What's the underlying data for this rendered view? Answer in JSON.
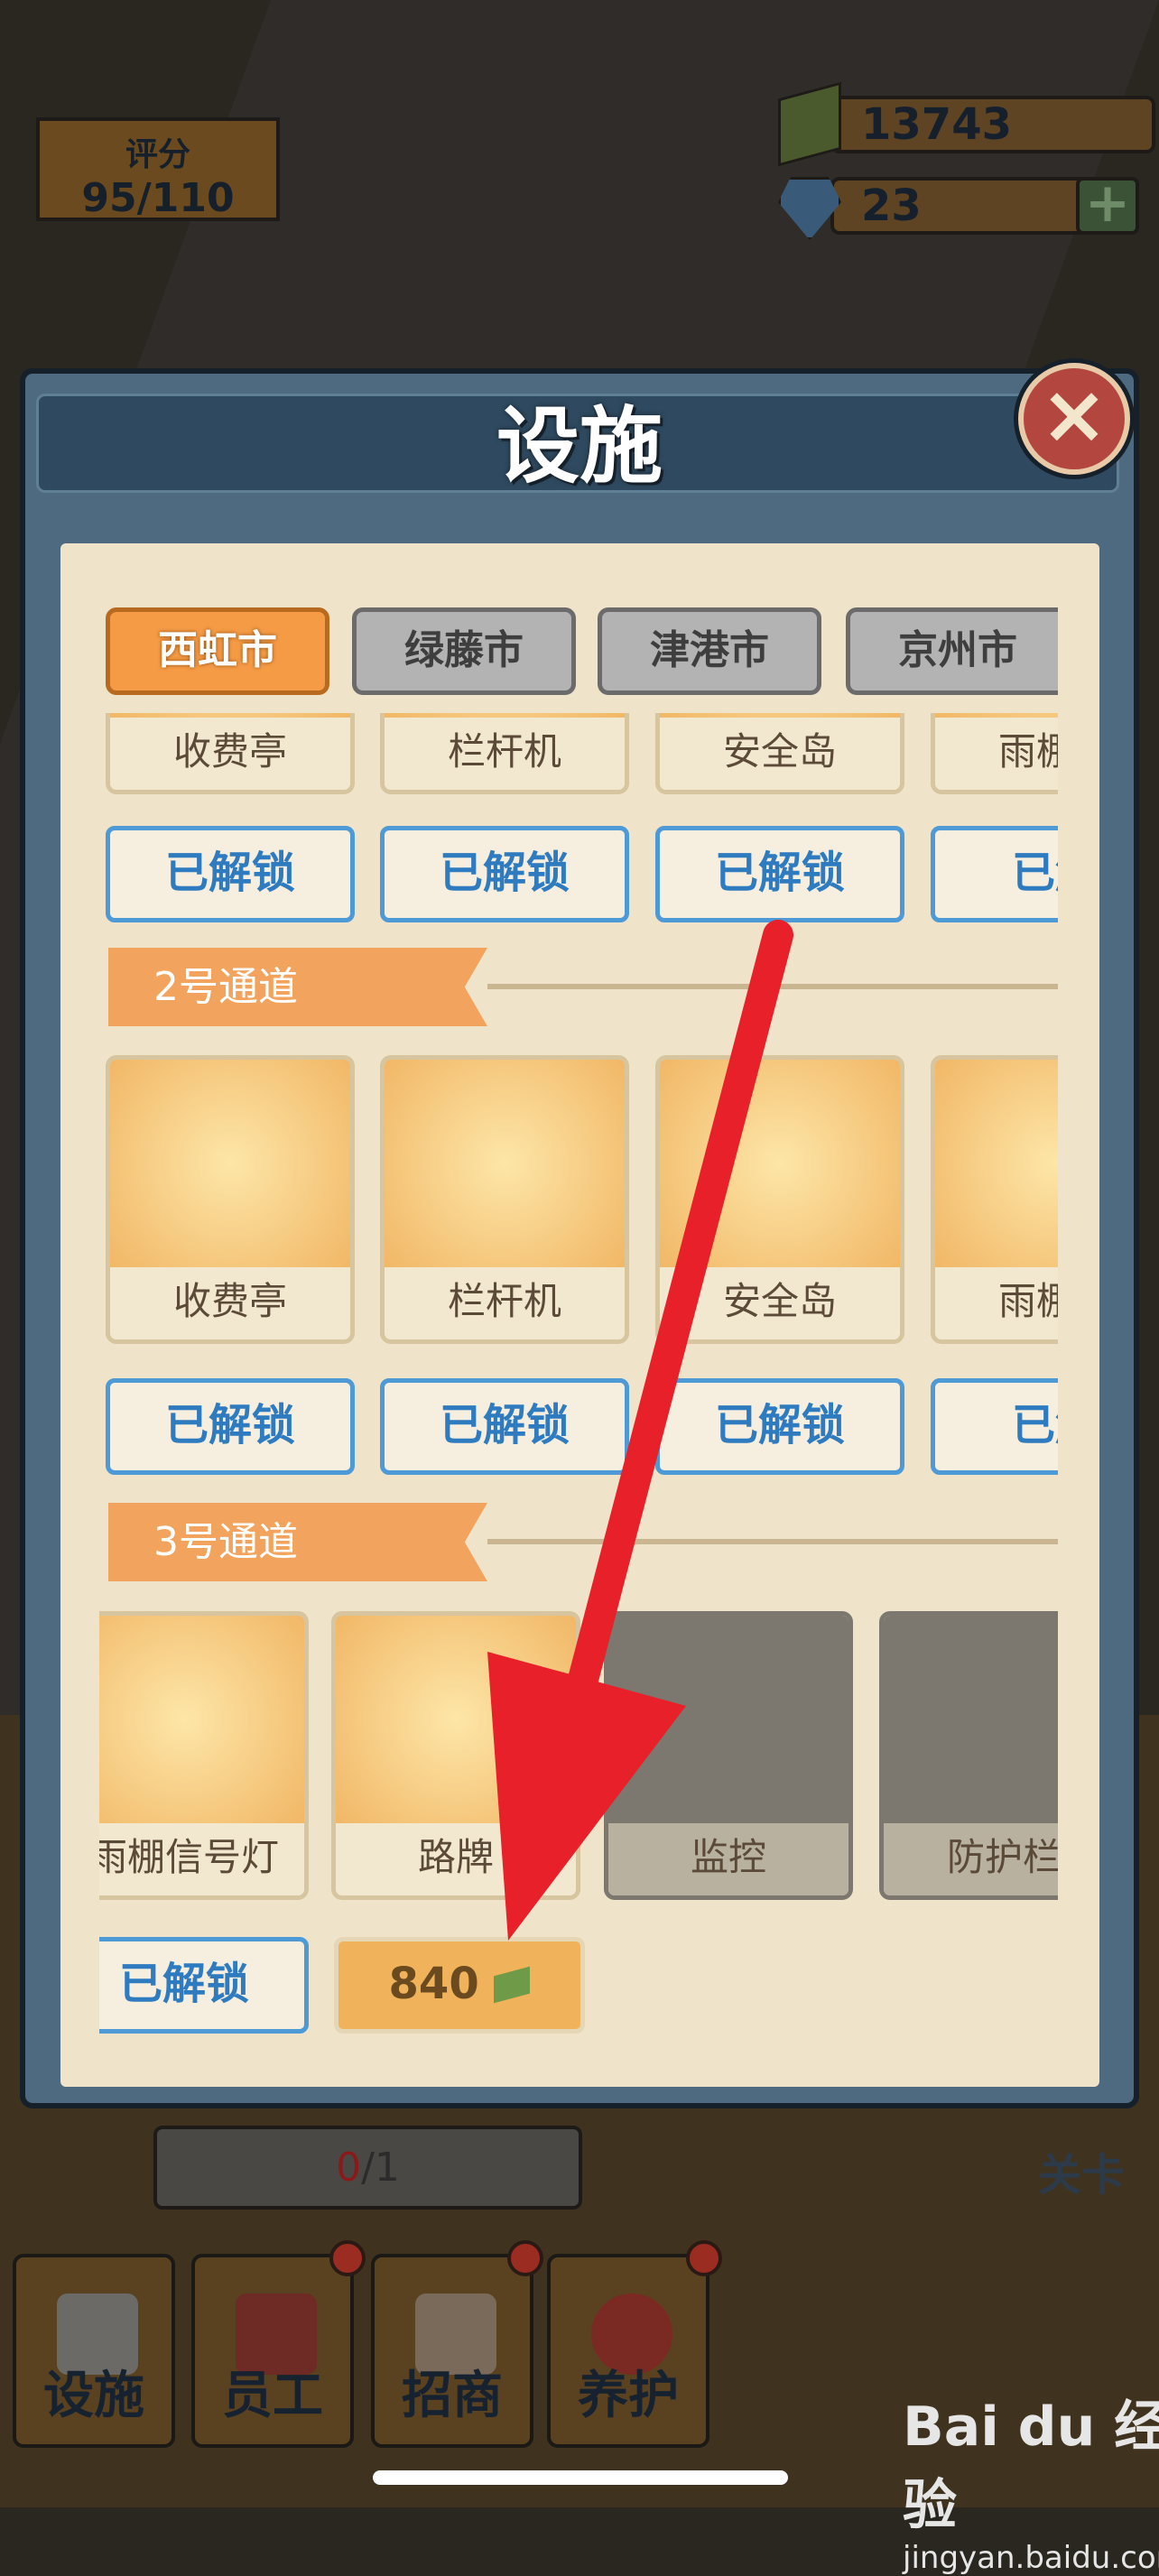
{
  "hud": {
    "rating_label": "评分",
    "rating_value": "95/110",
    "cash": "13743",
    "gems": "23",
    "plus": "+"
  },
  "dialog": {
    "title": "设施",
    "close": "×",
    "tabs": [
      {
        "label": "西虹市",
        "active": true
      },
      {
        "label": "绿藤市",
        "active": false
      },
      {
        "label": "津港市",
        "active": false
      },
      {
        "label": "京州市",
        "active": false
      }
    ],
    "lane1": {
      "items": [
        "收费亭",
        "栏杆机",
        "安全岛",
        "雨棚信"
      ],
      "status": [
        "已解锁",
        "已解锁",
        "已解锁",
        "已解"
      ]
    },
    "lane2": {
      "title": "2号通道",
      "items": [
        "收费亭",
        "栏杆机",
        "安全岛",
        "雨棚信"
      ],
      "status": [
        "已解锁",
        "已解锁",
        "已解锁",
        "已解"
      ]
    },
    "lane3": {
      "title": "3号通道",
      "items": [
        {
          "label": "雨棚信号灯",
          "locked": false
        },
        {
          "label": "路牌",
          "locked": false
        },
        {
          "label": "监控",
          "locked": true
        },
        {
          "label": "防护栏",
          "locked": true
        }
      ],
      "status": [
        "已解锁"
      ],
      "price": "840"
    }
  },
  "task_progress": {
    "done": "0",
    "total": "/1"
  },
  "level_label": "关卡",
  "bottom_nav": [
    {
      "label": "设施",
      "icon": "camera-icon",
      "badge": false
    },
    {
      "label": "员工",
      "icon": "staff-icon",
      "badge": true
    },
    {
      "label": "招商",
      "icon": "billboard-icon",
      "badge": true
    },
    {
      "label": "养护",
      "icon": "helmet-wrench-icon",
      "badge": true
    }
  ],
  "watermark": {
    "brand": "Bai du 经验",
    "url": "jingyan.baidu.com"
  },
  "colors": {
    "accent_tab": "#f59b45",
    "unlock_blue": "#2f7bc0",
    "annotation_arrow": "#e8202a"
  }
}
